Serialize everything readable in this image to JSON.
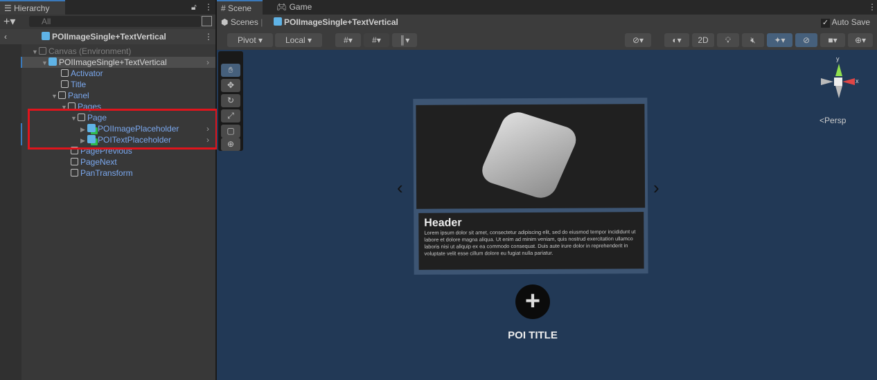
{
  "hierarchy": {
    "tab_label": "Hierarchy",
    "search_placeholder": "All",
    "prefab_title": "POIImageSingle+TextVertical",
    "items": [
      {
        "label": "Canvas (Environment)",
        "color": "grey"
      },
      {
        "label": "POIImageSingle+TextVertical"
      },
      {
        "label": "Activator"
      },
      {
        "label": "Title"
      },
      {
        "label": "Panel"
      },
      {
        "label": "Pages"
      },
      {
        "label": "Page"
      },
      {
        "label": "POIImagePlaceholder"
      },
      {
        "label": "POITextPlaceholder"
      },
      {
        "label": "PagePrevious"
      },
      {
        "label": "PageNext"
      },
      {
        "label": "PanTransform"
      }
    ],
    "highlight_color": "#e0141c"
  },
  "scene": {
    "tabs": [
      {
        "label": "Scene"
      },
      {
        "label": "Game"
      }
    ],
    "breadcrumb_root": "Scenes",
    "breadcrumb_prefab": "POIImageSingle+TextVertical",
    "auto_save_label": "Auto Save",
    "auto_save_checked": true,
    "toolbar": {
      "pivot": "Pivot",
      "local": "Local",
      "mode_2d": "2D"
    },
    "gizmo": {
      "persp": "Persp",
      "y": "y",
      "x": "x"
    },
    "card": {
      "header": "Header",
      "body": "Lorem ipsum dolor sit amet, consectetur adipiscing elit, sed do eiusmod tempor incididunt ut labore et dolore magna aliqua. Ut enim ad minim veniam, quis nostrud exercitation ullamco laboris nisi ut aliquip ex ea commodo consequat. Duis aute irure dolor in reprehenderit in voluptate velit esse cillum dolore eu fugiat nulla pariatur.",
      "prev": "‹",
      "next": "›"
    },
    "poi_title": "POI TITLE",
    "plus": "+"
  },
  "colors": {
    "scene_bg": "#223956",
    "accent": "#3a79bb"
  }
}
